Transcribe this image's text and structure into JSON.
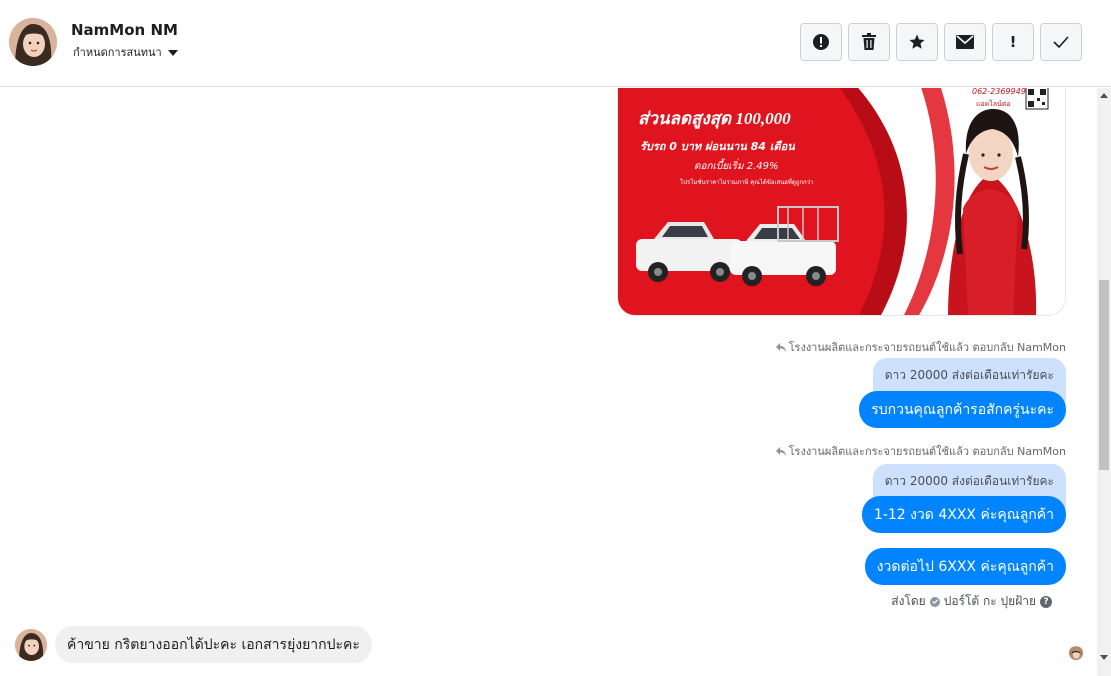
{
  "header": {
    "contact_name": "NamMon NM",
    "conversation_settings": "กำหนดการสนทนา",
    "actions": [
      {
        "name": "mark-spam-button",
        "icon": "alert-circle-icon"
      },
      {
        "name": "delete-button",
        "icon": "trash-icon"
      },
      {
        "name": "star-button",
        "icon": "star-icon"
      },
      {
        "name": "mark-unread-button",
        "icon": "envelope-icon"
      },
      {
        "name": "important-button",
        "icon": "exclamation-icon",
        "glyph": "!"
      },
      {
        "name": "done-button",
        "icon": "checkmark-icon"
      }
    ]
  },
  "promo": {
    "phone": "062-2369949",
    "line_label": "แอดไลน์ต่อ",
    "discount_line": "ส่วนลดสูงสุด 100,000",
    "down_line": "รับรถ 0 บาท ผ่อนนาน 84 เดือน",
    "interest_line": "ดอกเบี้ยเริ่ม 2.49%",
    "fine_print": "โปรโมชั่นราคาไม่รวมภาษี คุณได้ข้อเสนอที่ดูถูกกว่า"
  },
  "messages": {
    "reply_note_1": "โรงงานผลิตและกระจายรถยนต์ใช้แล้ว ตอบกลับ NamMon",
    "quoted_1": "ดาว 20000 ส่งต่อเดือนเท่ารัยคะ",
    "out_1": "รบกวนคุณลูกค้ารอสักครู่นะคะ",
    "reply_note_2": "โรงงานผลิตและกระจายรถยนต์ใช้แล้ว ตอบกลับ NamMon",
    "quoted_2": "ดาว 20000 ส่งต่อเดือนเท่ารัยคะ",
    "out_2": "1-12 งวด 4XXX ค่ะคุณลูกค้า",
    "out_3": "งวดต่อไป 6XXX ค่ะคุณลูกค้า",
    "sent_by_label": "ส่งโดย",
    "sent_by_name": "ปอร์โต้ กะ ปุยฝ้าย",
    "incoming_1": "ค้าขาย กริตยางออกได้ปะคะ เอกสารยุ่งยากปะคะ"
  },
  "colors": {
    "outgoing_bubble": "#0084ff",
    "quoted_bubble": "#cde1ff",
    "incoming_bubble": "#f1f0f0",
    "promo_red": "#e0141e"
  }
}
